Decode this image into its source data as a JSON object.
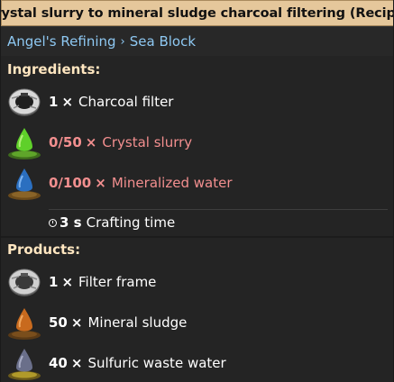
{
  "title": "Crystal slurry to mineral sludge charcoal filtering (Recipe)",
  "source": {
    "mod": "Angel's Refining",
    "separator": "›",
    "mod2": "Sea Block"
  },
  "ingredients": {
    "header": "Ingredients:",
    "items": [
      {
        "amount": "1",
        "times": "×",
        "name": "Charcoal filter",
        "icon": "charcoal-filter-icon",
        "missing": false
      },
      {
        "amount": "0/50",
        "times": "×",
        "name": "Crystal slurry",
        "icon": "crystal-slurry-icon",
        "missing": true
      },
      {
        "amount": "0/100",
        "times": "×",
        "name": "Mineralized water",
        "icon": "mineralized-water-icon",
        "missing": true
      }
    ],
    "crafting_time": "3 s",
    "crafting_time_label": "Crafting time"
  },
  "products": {
    "header": "Products:",
    "items": [
      {
        "amount": "1",
        "times": "×",
        "name": "Filter frame",
        "icon": "filter-frame-icon"
      },
      {
        "amount": "50",
        "times": "×",
        "name": "Mineral sludge",
        "icon": "mineral-sludge-icon"
      },
      {
        "amount": "40",
        "times": "×",
        "name": "Sulfuric waste water",
        "icon": "sulfuric-waste-water-icon"
      }
    ]
  },
  "colors": {
    "title_bg": "#e5c79b",
    "panel_bg": "#313131",
    "header_text": "#ffe6c0",
    "link_text": "#8ec8f2",
    "missing_text": "#f38f8f",
    "crystal_slurry": "#5fd02a",
    "mineralized_water": "#2b6fc0",
    "mineral_sludge": "#c86a1e",
    "sulfuric_waste_water": "#6a6f8a"
  }
}
